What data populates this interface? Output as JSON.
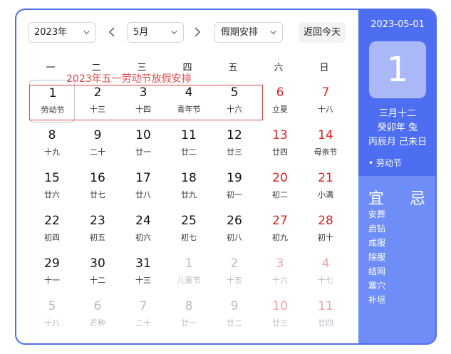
{
  "toolbar": {
    "year": "2023年",
    "month": "5月",
    "holiday": "假期安排",
    "today_button": "返回今天"
  },
  "weekdays": [
    "一",
    "二",
    "三",
    "四",
    "五",
    "六",
    "日"
  ],
  "annotation": "2023年五一劳动节放假安排",
  "weeks": [
    [
      {
        "d": "1",
        "l": "劳动节"
      },
      {
        "d": "2",
        "l": "十三"
      },
      {
        "d": "3",
        "l": "十四"
      },
      {
        "d": "4",
        "l": "青年节"
      },
      {
        "d": "5",
        "l": "十六"
      },
      {
        "d": "6",
        "l": "立夏"
      },
      {
        "d": "7",
        "l": "十八"
      }
    ],
    [
      {
        "d": "8",
        "l": "十九"
      },
      {
        "d": "9",
        "l": "二十"
      },
      {
        "d": "10",
        "l": "廿一"
      },
      {
        "d": "11",
        "l": "廿二"
      },
      {
        "d": "12",
        "l": "廿三"
      },
      {
        "d": "13",
        "l": "廿四"
      },
      {
        "d": "14",
        "l": "母亲节"
      }
    ],
    [
      {
        "d": "15",
        "l": "廿六"
      },
      {
        "d": "16",
        "l": "廿七"
      },
      {
        "d": "17",
        "l": "廿八"
      },
      {
        "d": "18",
        "l": "廿九"
      },
      {
        "d": "19",
        "l": "初一"
      },
      {
        "d": "20",
        "l": "初二"
      },
      {
        "d": "21",
        "l": "小满"
      }
    ],
    [
      {
        "d": "22",
        "l": "初四"
      },
      {
        "d": "23",
        "l": "初五"
      },
      {
        "d": "24",
        "l": "初六"
      },
      {
        "d": "25",
        "l": "初七"
      },
      {
        "d": "26",
        "l": "初八"
      },
      {
        "d": "27",
        "l": "初九"
      },
      {
        "d": "28",
        "l": "初十"
      }
    ],
    [
      {
        "d": "29",
        "l": "十一"
      },
      {
        "d": "30",
        "l": "十二"
      },
      {
        "d": "31",
        "l": "十三"
      },
      {
        "d": "1",
        "l": "儿童节"
      },
      {
        "d": "2",
        "l": "十五"
      },
      {
        "d": "3",
        "l": "十六"
      },
      {
        "d": "4",
        "l": "十七"
      }
    ],
    [
      {
        "d": "5",
        "l": "十八"
      },
      {
        "d": "6",
        "l": "芒种"
      },
      {
        "d": "7",
        "l": "二十"
      },
      {
        "d": "8",
        "l": "廿一"
      },
      {
        "d": "9",
        "l": "廿二"
      },
      {
        "d": "10",
        "l": "廿三"
      },
      {
        "d": "11",
        "l": "廿四"
      }
    ]
  ],
  "panel": {
    "date": "2023-05-01",
    "day": "1",
    "lunar": "三月十二",
    "year_gz": "癸卯年 兔",
    "month_day_gz": "丙辰月 己未日",
    "festival": "• 劳动节",
    "yi": "宜",
    "ji": "忌",
    "yi_items": [
      "安葬",
      "启钻",
      "成服",
      "除服",
      "结网",
      "塞穴",
      "补垣"
    ]
  },
  "colors": {
    "accent": "#4e6ef2",
    "accent_light": "#6f8df6",
    "weekend_red": "#e02020",
    "annotation_red": "#e04848"
  }
}
